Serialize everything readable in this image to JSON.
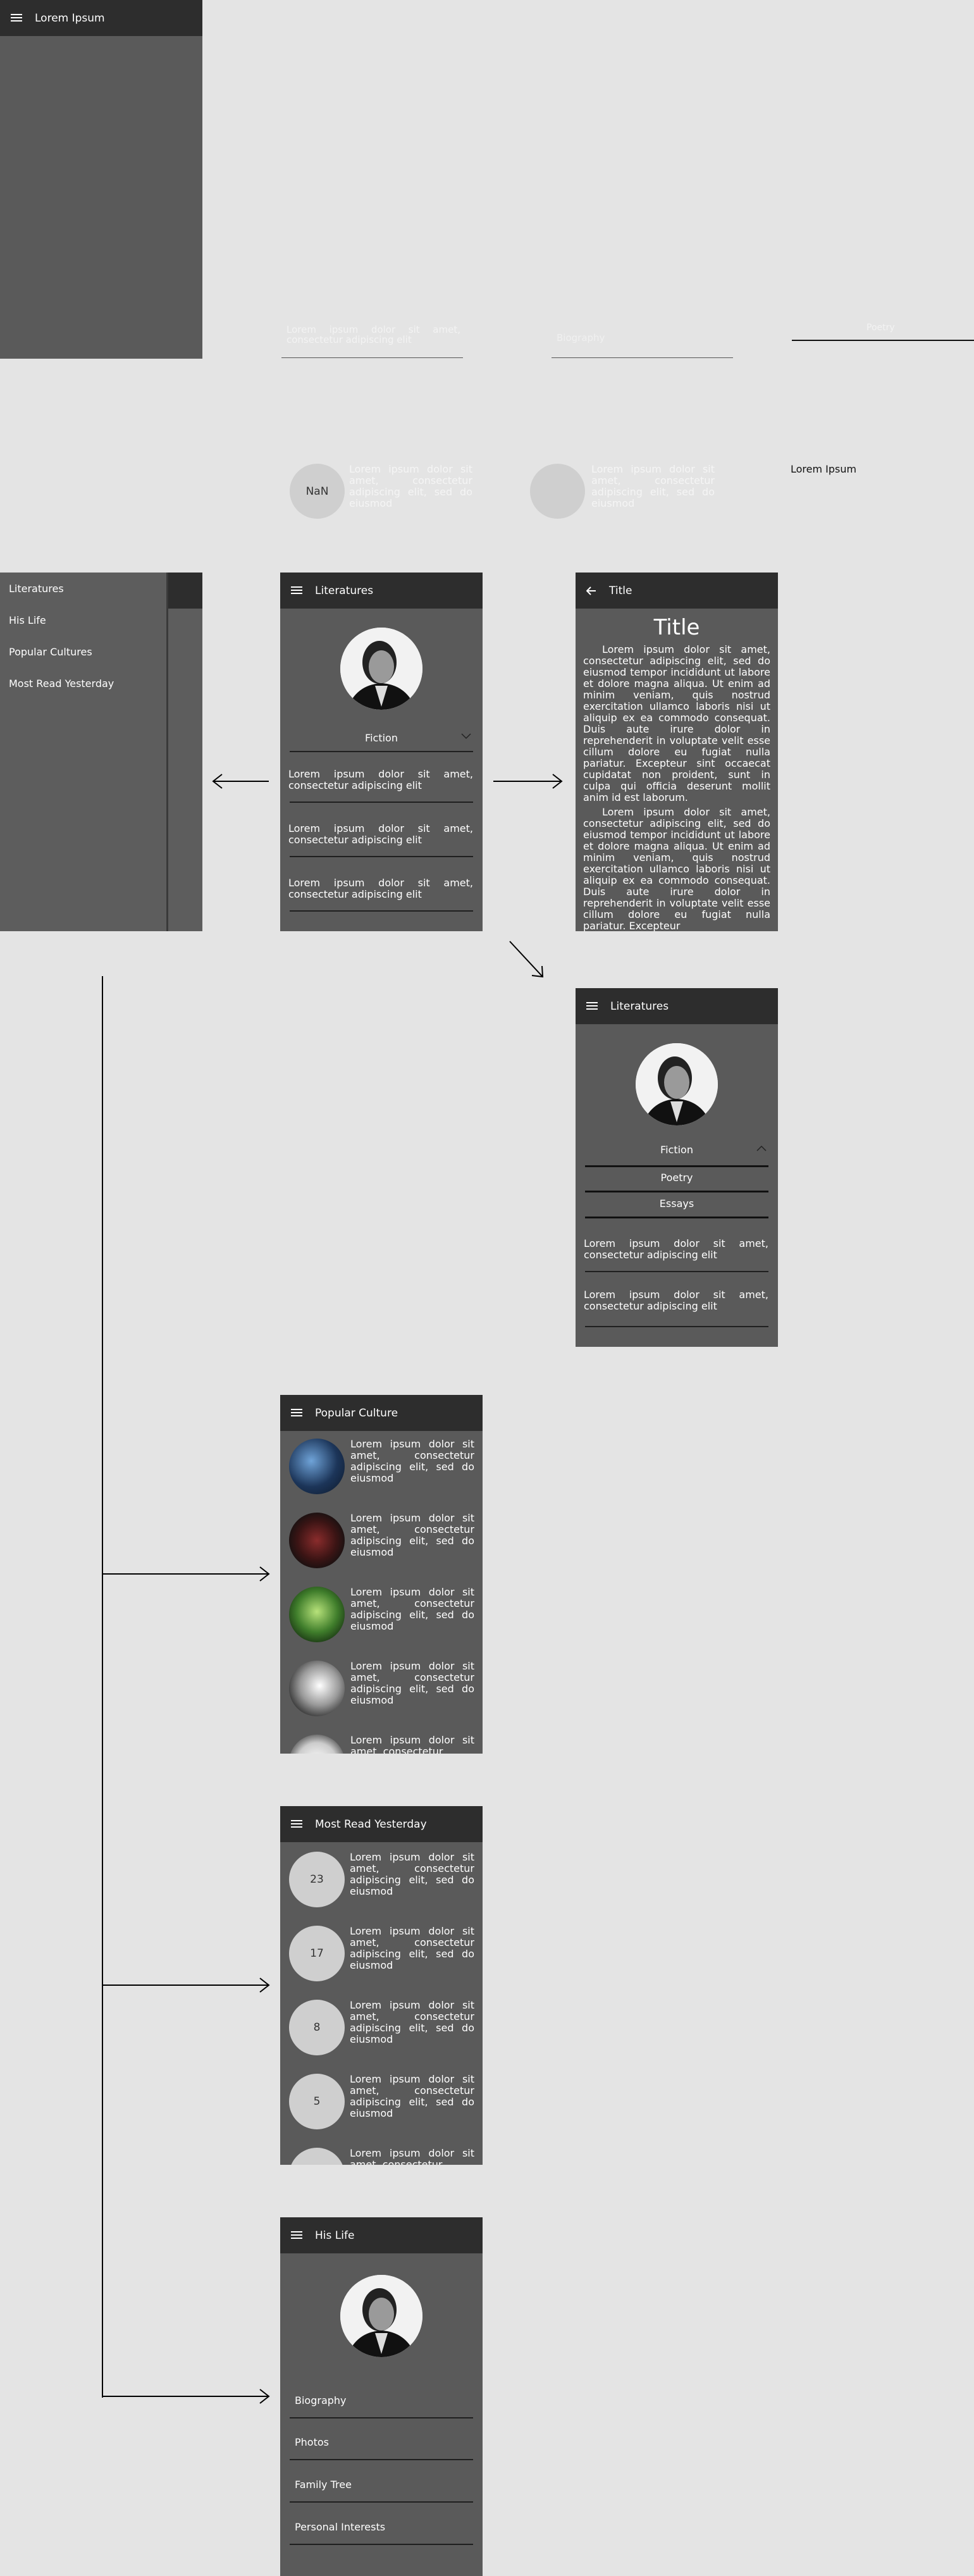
{
  "panel_top_left": {
    "title": "Lorem Ipsum"
  },
  "floating": {
    "field1_text": "Lorem ipsum dolor sit amet, consectetur adipiscing elit",
    "field2_placeholder": "Biography",
    "field3_text": "Poetry",
    "circle1_label": "NaN",
    "circle_text1": "Lorem ipsum dolor sit amet, consectetur adipiscing elit, sed do eiusmod",
    "circle_text2": "Lorem ipsum dolor sit amet, consectetur adipiscing elit, sed do eiusmod",
    "lorem_label": "Lorem Ipsum"
  },
  "drawer": {
    "items": [
      "Literatures",
      "His Life",
      "Popular Cultures",
      "Most Read Yesterday"
    ]
  },
  "literatures": {
    "title": "Literatures",
    "dropdown": "Fiction",
    "items": [
      "Lorem ipsum dolor sit amet, consectetur adipiscing elit",
      "Lorem ipsum dolor sit amet, consectetur adipiscing elit",
      "Lorem ipsum dolor sit amet, consectetur adipiscing elit"
    ]
  },
  "article": {
    "header": "Title",
    "heading": "Title",
    "p1": "Lorem ipsum dolor sit amet, consectetur adipiscing elit, sed do eiusmod tempor incididunt ut labore et dolore magna aliqua. Ut enim ad minim veniam, quis nostrud exercitation ullamco laboris nisi ut aliquip ex ea commodo consequat. Duis aute irure dolor in reprehenderit in voluptate velit esse cillum dolore eu fugiat nulla pariatur. Excepteur sint occaecat cupidatat non proident, sunt in culpa qui officia deserunt mollit anim id est laborum.",
    "p2": "Lorem ipsum dolor sit amet, consectetur adipiscing elit, sed do eiusmod tempor incididunt ut labore et dolore magna aliqua. Ut enim ad minim veniam, quis nostrud exercitation ullamco laboris nisi ut aliquip ex ea commodo consequat. Duis aute irure dolor in reprehenderit in voluptate velit esse cillum dolore eu fugiat nulla pariatur. Excepteur"
  },
  "literatures_expanded": {
    "title": "Literatures",
    "dropdown": "Fiction",
    "options": [
      "Poetry",
      "Essays"
    ],
    "items": [
      "Lorem ipsum dolor sit amet, consectetur adipiscing elit",
      "Lorem ipsum dolor sit amet, consectetur adipiscing elit"
    ]
  },
  "popular_culture": {
    "title": "Popular Culture",
    "items": [
      "Lorem ipsum dolor sit amet, consectetur adipiscing elit, sed do eiusmod",
      "Lorem ipsum dolor sit amet, consectetur adipiscing elit, sed do eiusmod",
      "Lorem ipsum dolor sit amet, consectetur adipiscing elit, sed do eiusmod",
      "Lorem ipsum dolor sit amet, consectetur adipiscing elit, sed do eiusmod",
      "Lorem ipsum dolor sit amet, consectetur"
    ]
  },
  "most_read": {
    "title": "Most Read Yesterday",
    "counts": [
      "23",
      "17",
      "8",
      "5"
    ],
    "items": [
      "Lorem ipsum dolor sit amet, consectetur adipiscing elit, sed do eiusmod",
      "Lorem ipsum dolor sit amet, consectetur adipiscing elit, sed do eiusmod",
      "Lorem ipsum dolor sit amet, consectetur adipiscing elit, sed do eiusmod",
      "Lorem ipsum dolor sit amet, consectetur adipiscing elit, sed do eiusmod",
      "Lorem ipsum dolor sit amet, consectetur"
    ]
  },
  "his_life": {
    "title": "His Life",
    "items": [
      "Biography",
      "Photos",
      "Family Tree",
      "Personal Interests"
    ]
  }
}
